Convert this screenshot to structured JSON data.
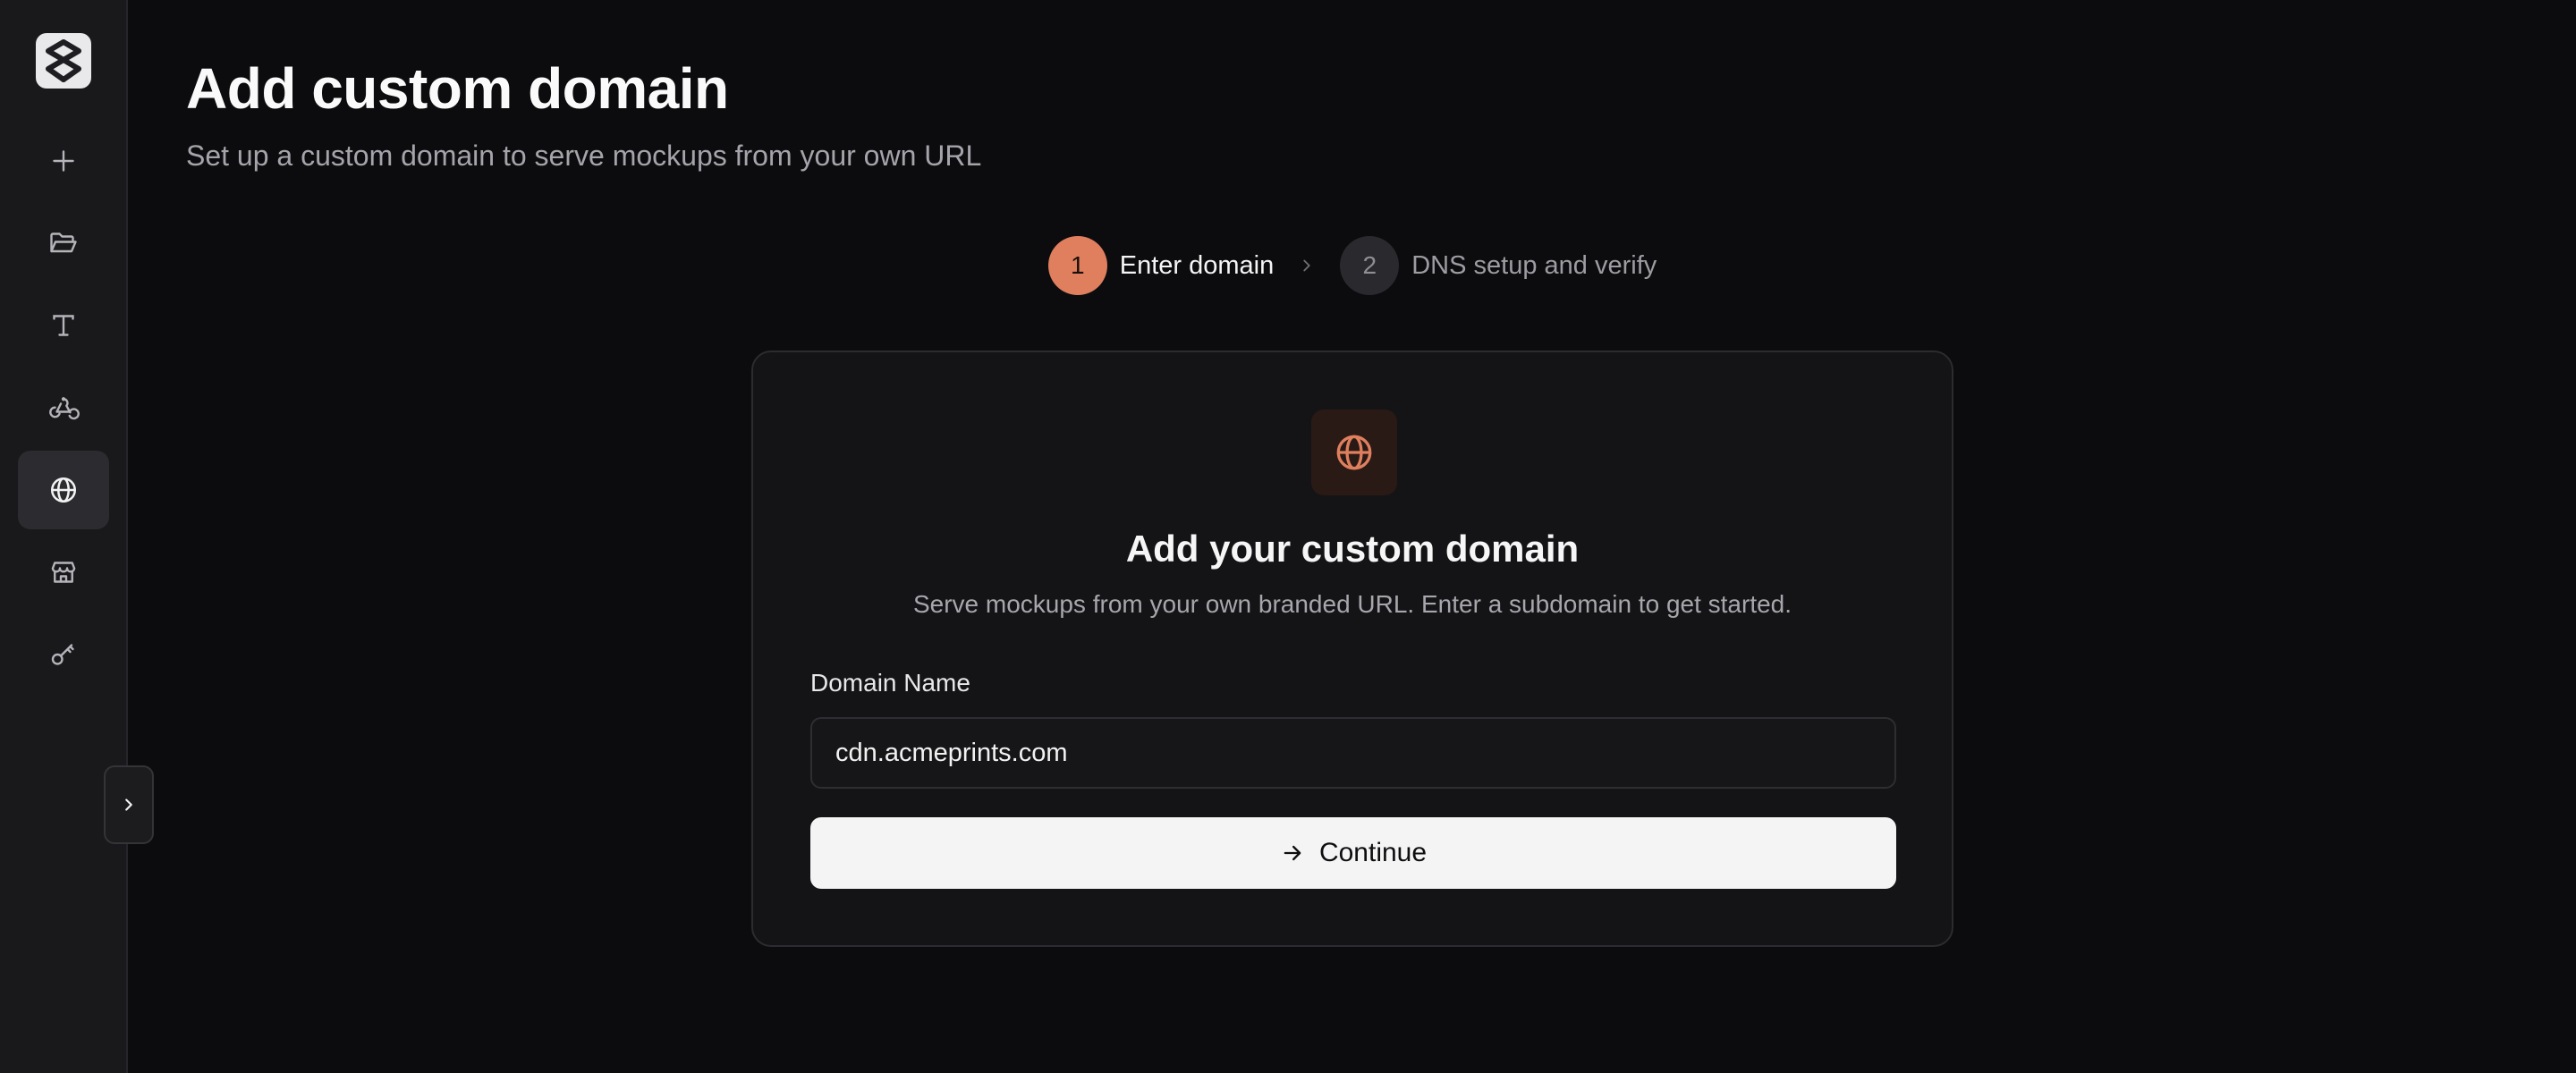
{
  "sidebar": {
    "logo_icon": "brand-logo-icon",
    "items": [
      {
        "name": "new",
        "icon": "plus-icon",
        "active": false
      },
      {
        "name": "projects",
        "icon": "folder-open-icon",
        "active": false
      },
      {
        "name": "text",
        "icon": "type-icon",
        "active": false
      },
      {
        "name": "webhooks",
        "icon": "webhook-icon",
        "active": false
      },
      {
        "name": "domains",
        "icon": "globe-icon",
        "active": true
      },
      {
        "name": "store",
        "icon": "store-icon",
        "active": false
      },
      {
        "name": "api-keys",
        "icon": "key-icon",
        "active": false
      }
    ],
    "collapse_icon": "chevron-right-icon"
  },
  "header": {
    "title": "Add custom domain",
    "subtitle": "Set up a custom domain to serve mockups from your own URL"
  },
  "stepper": {
    "steps": [
      {
        "number": "1",
        "label": "Enter domain",
        "active": true
      },
      {
        "number": "2",
        "label": "DNS setup and verify",
        "active": false
      }
    ]
  },
  "card": {
    "icon": "globe-icon",
    "title": "Add your custom domain",
    "description": "Serve mockups from your own branded URL. Enter a subdomain to get started.",
    "field_label": "Domain Name",
    "field_value": "cdn.acmeprints.com",
    "button_label": "Continue"
  },
  "colors": {
    "accent": "#df7f5e",
    "background": "#0c0c0e",
    "sidebar": "#19191b",
    "card": "#141416"
  }
}
